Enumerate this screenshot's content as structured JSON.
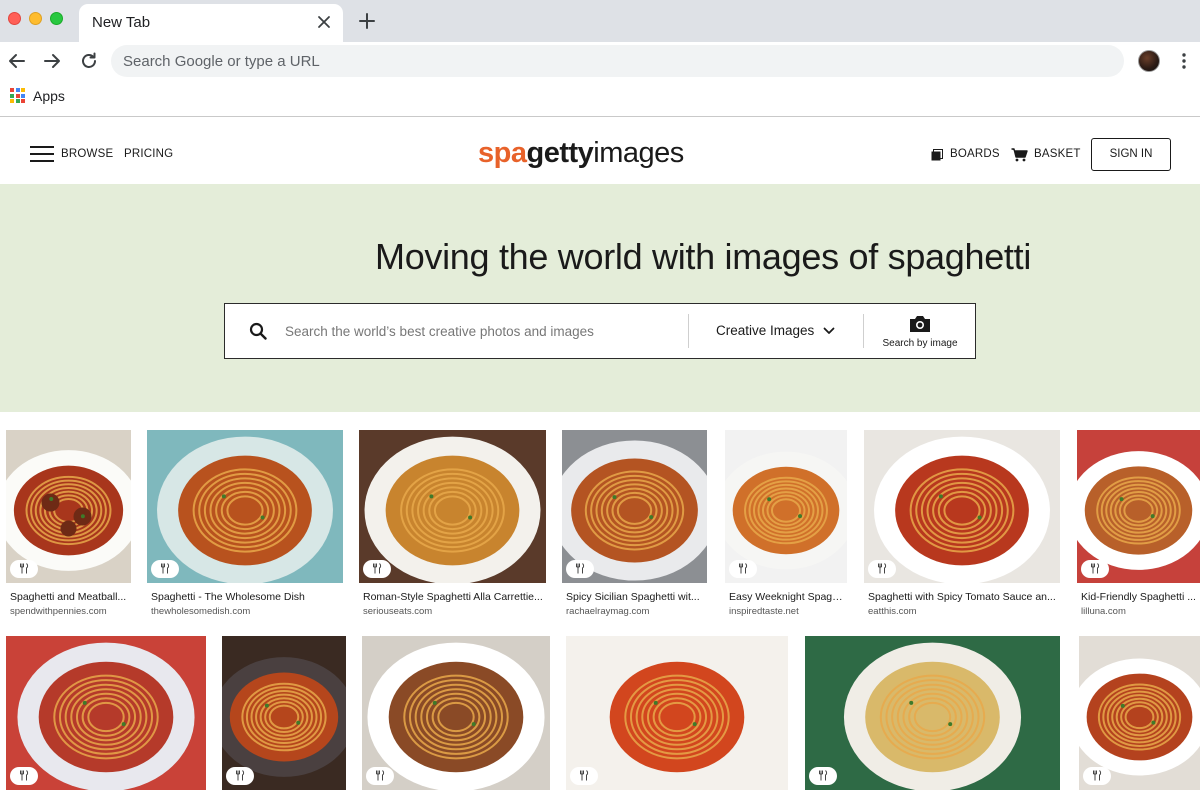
{
  "browser": {
    "tab_title": "New Tab",
    "omnibox_placeholder": "Search Google or type a URL",
    "bookmarks": {
      "apps_label": "Apps"
    },
    "colors": {
      "tabstrip": "#dee1e6",
      "omnibox": "#f1f3f4"
    }
  },
  "site": {
    "logo": {
      "part1": "spa",
      "part2": "getty",
      "part3": "images"
    },
    "nav": {
      "browse": "BROWSE",
      "pricing": "PRICING",
      "boards": "BOARDS",
      "basket": "BASKET",
      "sign_in": "SIGN IN"
    },
    "hero": {
      "title": "Moving the world with images of spaghetti",
      "search_placeholder": "Search the world’s best creative photos and images",
      "category": "Creative Images",
      "search_by_image": "Search by image"
    },
    "colors": {
      "accent": "#e8622a",
      "hero_bg": "#e4edd9"
    },
    "icons": [
      "hamburger-icon",
      "boards-icon",
      "basket-icon",
      "search-icon",
      "chevron-down-icon",
      "camera-icon",
      "fork-knife-icon"
    ]
  },
  "results": {
    "row1": [
      {
        "title": "Spaghetti and Meatball...",
        "source": "spendwithpennies.com"
      },
      {
        "title": "Spaghetti - The Wholesome Dish",
        "source": "thewholesomedish.com"
      },
      {
        "title": "Roman-Style Spaghetti Alla Carrettie...",
        "source": "seriouseats.com"
      },
      {
        "title": "Spicy Sicilian Spaghetti wit...",
        "source": "rachaelraymag.com"
      },
      {
        "title": "Easy Weeknight Spagh...",
        "source": "inspiredtaste.net"
      },
      {
        "title": "Spaghetti with Spicy Tomato Sauce an...",
        "source": "eatthis.com"
      },
      {
        "title": "Kid-Friendly Spaghetti ...",
        "source": "lilluna.com"
      }
    ],
    "row2_count": 6
  }
}
